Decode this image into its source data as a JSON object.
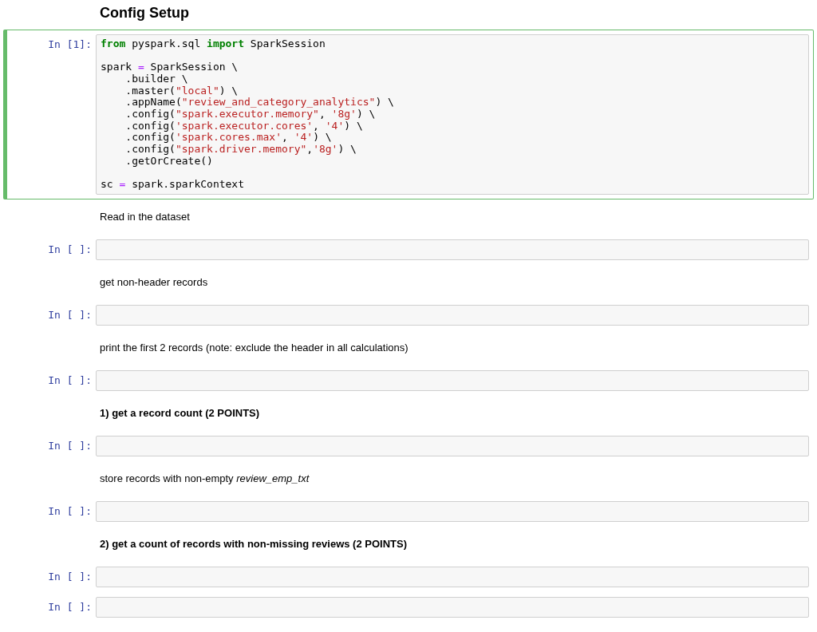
{
  "cells": [
    {
      "kind": "heading",
      "text": "Config Setup"
    },
    {
      "kind": "code",
      "prompt": "In [1]:",
      "selected": true,
      "code": [
        {
          "kind": "kw",
          "text": "from"
        },
        {
          "kind": "plain",
          "text": " pyspark.sql "
        },
        {
          "kind": "kw",
          "text": "import"
        },
        {
          "kind": "plain",
          "text": " SparkSession\n\nspark "
        },
        {
          "kind": "op",
          "text": "="
        },
        {
          "kind": "plain",
          "text": " SparkSession \\\n    .builder \\\n    .master("
        },
        {
          "kind": "str",
          "text": "\"local\""
        },
        {
          "kind": "plain",
          "text": ") \\\n    .appName("
        },
        {
          "kind": "str",
          "text": "\"review_and_category_analytics\""
        },
        {
          "kind": "plain",
          "text": ") \\\n    .config("
        },
        {
          "kind": "str",
          "text": "\"spark.executor.memory\""
        },
        {
          "kind": "plain",
          "text": ", "
        },
        {
          "kind": "str",
          "text": "'8g'"
        },
        {
          "kind": "plain",
          "text": ") \\\n    .config("
        },
        {
          "kind": "str",
          "text": "'spark.executor.cores'"
        },
        {
          "kind": "plain",
          "text": ", "
        },
        {
          "kind": "str",
          "text": "'4'"
        },
        {
          "kind": "plain",
          "text": ") \\\n    .config("
        },
        {
          "kind": "str",
          "text": "'spark.cores.max'"
        },
        {
          "kind": "plain",
          "text": ", "
        },
        {
          "kind": "str",
          "text": "'4'"
        },
        {
          "kind": "plain",
          "text": ") \\\n    .config("
        },
        {
          "kind": "str",
          "text": "\"spark.driver.memory\""
        },
        {
          "kind": "plain",
          "text": ","
        },
        {
          "kind": "str",
          "text": "'8g'"
        },
        {
          "kind": "plain",
          "text": ") \\\n    .getOrCreate()\n\nsc "
        },
        {
          "kind": "op",
          "text": "="
        },
        {
          "kind": "plain",
          "text": " spark.sparkContext"
        }
      ]
    },
    {
      "kind": "text",
      "text": "Read in the dataset"
    },
    {
      "kind": "code",
      "prompt": "In [ ]:",
      "selected": false
    },
    {
      "kind": "text",
      "text": "get non-header records"
    },
    {
      "kind": "code",
      "prompt": "In [ ]:",
      "selected": false
    },
    {
      "kind": "text",
      "text": "print the first 2 records (note: exclude the header in all calculations)"
    },
    {
      "kind": "code",
      "prompt": "In [ ]:",
      "selected": false
    },
    {
      "kind": "task",
      "text": "1) get a record count (2 POINTS)"
    },
    {
      "kind": "code",
      "prompt": "In [ ]:",
      "selected": false
    },
    {
      "kind": "text",
      "text": "store records with non-empty *review_emp_txt*"
    },
    {
      "kind": "code",
      "prompt": "In [ ]:",
      "selected": false
    },
    {
      "kind": "task",
      "text": "2) get a count of records with non-missing reviews (2 POINTS)"
    },
    {
      "kind": "code",
      "prompt": "In [ ]:",
      "selected": false
    },
    {
      "kind": "code",
      "prompt": "In [ ]:",
      "selected": false
    }
  ]
}
